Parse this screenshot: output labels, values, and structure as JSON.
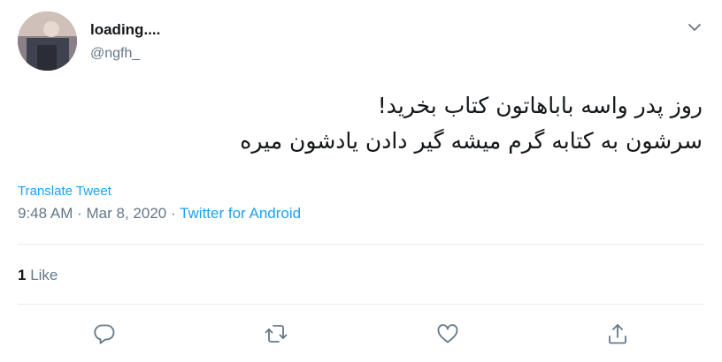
{
  "author": {
    "display_name": "loading....",
    "handle": "@ngfh_",
    "avatar_icon": "user-photo-avatar"
  },
  "tweet": {
    "lines": [
      "روز پدر واسه باباهاتون کتاب بخرید!",
      "سرشون به کتابه گرم میشه گیر دادن یادشون میره"
    ],
    "translate_label": "Translate Tweet",
    "time": "9:48 AM",
    "separator": "·",
    "date": "Mar 8, 2020",
    "source": "Twitter for Android"
  },
  "stats": {
    "likes_count": "1",
    "likes_label": "Like"
  },
  "actions": {
    "icons": [
      "reply-icon",
      "retweet-icon",
      "like-icon",
      "share-icon"
    ]
  },
  "colors": {
    "accent": "#1da1f2",
    "muted": "#657786",
    "text": "#14171a",
    "divider": "#e6ecf0"
  }
}
